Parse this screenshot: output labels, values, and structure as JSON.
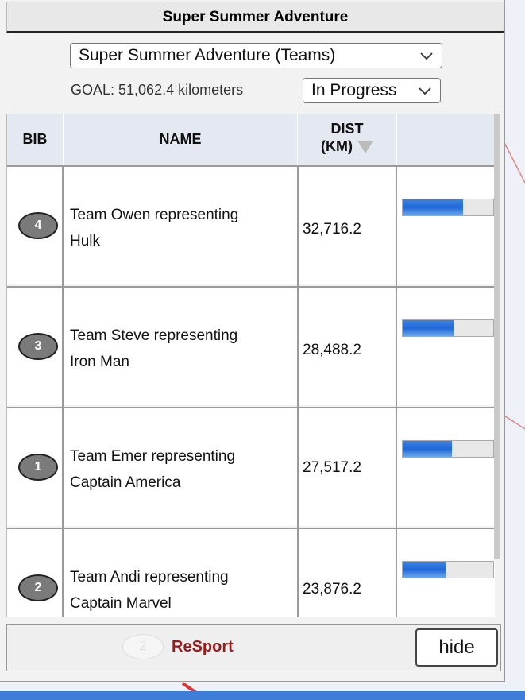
{
  "title": "Super Summer Adventure",
  "event_select": {
    "value": "Super Summer Adventure (Teams)",
    "icon": "chevron-down-icon"
  },
  "goal_text": "GOAL: 51,062.4 kilometers",
  "status_select": {
    "value": "In Progress",
    "icon": "chevron-down-icon"
  },
  "table": {
    "headers": {
      "bib": "BIB",
      "name": "NAME",
      "dist_line1": "DIST",
      "dist_line2": "(KM)"
    },
    "sort_icon": "sort-descending-icon",
    "rows": [
      {
        "bib": "4",
        "name_line1": "Team Owen representing",
        "name_line2": "Hulk",
        "dist": "32,716.2",
        "progress": 0.67
      },
      {
        "bib": "3",
        "name_line1": "Team Steve representing",
        "name_line2": "Iron Man",
        "dist": "28,488.2",
        "progress": 0.56
      },
      {
        "bib": "1",
        "name_line1": "Team Emer representing",
        "name_line2": "Captain America",
        "dist": "27,517.2",
        "progress": 0.54
      },
      {
        "bib": "2",
        "name_line1": "Team Andi representing",
        "name_line2": "Captain Marvel",
        "dist": "23,876.2",
        "progress": 0.47
      }
    ]
  },
  "footer": {
    "bib": "2",
    "brand": "ReSport",
    "hide_label": "hide"
  },
  "colors": {
    "brand": "#9a1a1a",
    "progress": "#2068d8",
    "header_bg": "#e4e8f0"
  }
}
